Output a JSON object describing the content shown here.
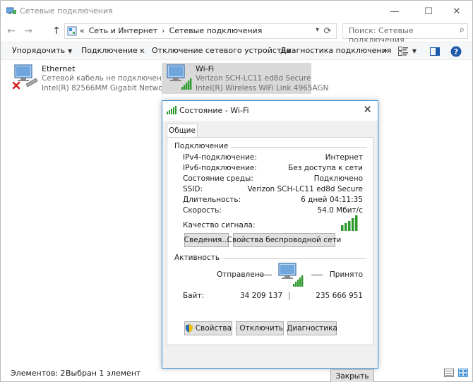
{
  "window": {
    "title": "Сетевые подключения",
    "controls": {
      "minimize": "—",
      "maximize": "☐",
      "close": "✕"
    }
  },
  "address": {
    "back": "←",
    "forward": "→",
    "up": "↑",
    "prefix": "«",
    "crumbs": [
      "Сеть и Интернет",
      "Сетевые подключения"
    ],
    "separator": "›",
    "refresh": "⟳"
  },
  "search": {
    "placeholder": "Поиск: Сетевые подключения"
  },
  "commandbar": {
    "organize": "Упорядочить",
    "connect": "Подключение к",
    "disable": "Отключение сетевого устройства",
    "diagnose": "Диагностика подключения",
    "more": "»"
  },
  "connections": [
    {
      "name": "Ethernet",
      "status": "Сетевой кабель не подключен",
      "adapter": "Intel(R) 82566MM Gigabit Networ..."
    },
    {
      "name": "Wi-Fi",
      "status": "Verizon SCH-LC11 ed8d Secure",
      "adapter": "Intel(R) Wireless WiFi Link 4965AGN"
    }
  ],
  "statusbar": {
    "items_count": "Элементов: 2",
    "selected": "Выбран 1 элемент"
  },
  "dialog": {
    "title": "Состояние - Wi-Fi",
    "close": "✕",
    "tab": "Общие",
    "connection_group": "Подключение",
    "rows": [
      {
        "label": "IPv4-подключение:",
        "value": "Интернет"
      },
      {
        "label": "IPv6-подключение:",
        "value": "Без доступа к сети"
      },
      {
        "label": "Состояние среды:",
        "value": "Подключено"
      },
      {
        "label": "SSID:",
        "value": "Verizon SCH-LC11 ed8d Secure"
      },
      {
        "label": "Длительность:",
        "value": "6 дней 04:11:35"
      },
      {
        "label": "Скорость:",
        "value": "54.0 Мбит/с"
      }
    ],
    "signal_label": "Качество сигнала:",
    "details_button": "Сведения...",
    "wireless_props_button": "Свойства беспроводной сети",
    "activity_group": "Активность",
    "sent_label": "Отправлено",
    "received_label": "Принято",
    "bytes_label": "Байт:",
    "bytes_sent": "34 209 137",
    "bytes_received": "235 666 951",
    "properties_button": "Свойства",
    "disable_button": "Отключить",
    "diagnose_button": "Диагностика",
    "close_button": "Закрыть"
  },
  "colors": {
    "accent": "#3c8fd3",
    "selection": "#d9d9d9",
    "signal_green": "#2e9a2e",
    "error_red": "#d42020"
  }
}
